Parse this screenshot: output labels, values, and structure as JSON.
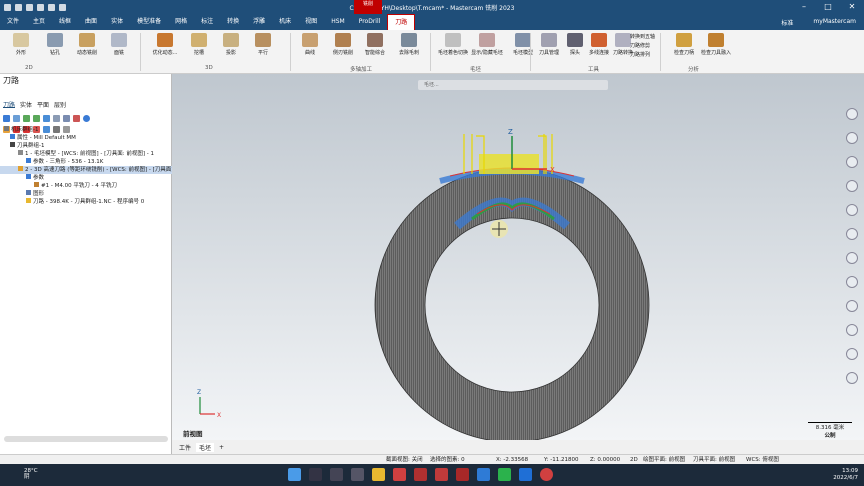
{
  "title": "C:\\Users\\ZYH\\Desktop\\T.mcam* - Mastercam 铣削 2023",
  "context_tab": "铣削",
  "menu": [
    "文件",
    "主页",
    "线框",
    "曲面",
    "实体",
    "模型准备",
    "网格",
    "标注",
    "转换",
    "浮雕",
    "机床",
    "视图",
    "HSM",
    "ProDrill",
    "刀路"
  ],
  "menu_right": [
    "标准",
    "myMastercam"
  ],
  "ribbon": {
    "buttons_2d": [
      "外形",
      "钻孔",
      "动态铣削",
      "面铣"
    ],
    "buttons_3d": [
      "优化动态...",
      "挖槽",
      "投影",
      "平行"
    ],
    "buttons_multi": [
      "曲线",
      "侧刃铣削",
      "智能综合",
      "去除毛刺"
    ],
    "buttons_stock": [
      "毛坯着色切换",
      "显示/隐藏毛坯",
      "毛坯模型"
    ],
    "buttons_tool": [
      "刀具管理",
      "探头",
      "多线连接",
      "刀路转换"
    ],
    "buttons_tool_small": [
      "转换到五轴",
      "刀路修剪",
      "刀路排列"
    ],
    "buttons_analysis": [
      "检查刀柄",
      "检查刀具融入"
    ],
    "groups": [
      "2D",
      "3D",
      "多轴加工",
      "毛坯",
      "工具",
      "分析"
    ]
  },
  "panel": {
    "title": "刀路",
    "tabs": [
      "刀路",
      "实体",
      "平面",
      "层别"
    ],
    "tree": [
      "机床群组-1",
      "属性 - Mill Default MM",
      "刀具群组-1",
      "1 - 毛坯模型 - [WCS: 前视图] - [刀具面: 前视图] - 1",
      "参数 - 三角形 - 536 - 13.1K",
      "2 - 3D 高速刀路 (等距环绕铣削) - [WCS: 前视图] - [刀具面]",
      "参数",
      "#1 - M4.00 平铣刀 - 4 平铣刀",
      "图形",
      "刀路 - 398.4K - 刀具群组-1.NC - 程序编号 0"
    ]
  },
  "viewport": {
    "view_name": "前视图",
    "scale": "8.316 毫米",
    "unit": "公制",
    "mini_toolbar": "毛坯..."
  },
  "bottom_tabs": [
    "工件",
    "毛坯"
  ],
  "status": {
    "section_view": "截面视图: 关闭",
    "selected": "选择的图素: 0",
    "x": "X:   -2.33568",
    "y": "Y:   -11.21800",
    "z": "Z:   0.00000",
    "mode": "2D",
    "draw_plane": "绘图平面: 前视图",
    "tool_plane": "刀具平面: 前视图",
    "wcs": "WCS: 俯视图"
  },
  "taskbar": {
    "temp": "28°C",
    "weather": "阴",
    "time": "13:09",
    "date": "2022/6/7"
  },
  "colors": {
    "title": "#1f4e79",
    "accent": "#c00000"
  }
}
